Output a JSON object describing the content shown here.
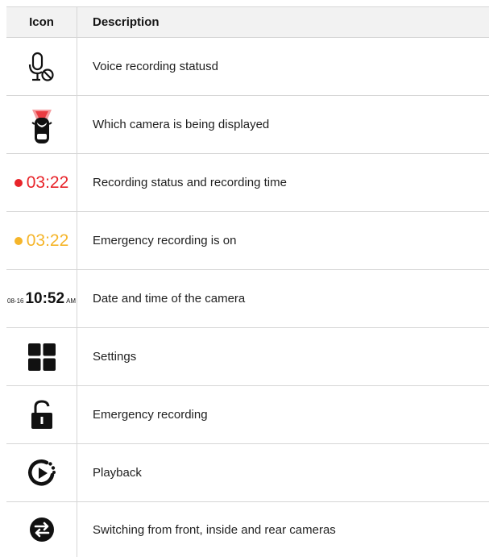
{
  "table": {
    "header": {
      "icon": "Icon",
      "description": "Description"
    },
    "rows": [
      {
        "icon_name": "microphone-off-icon",
        "description": "Voice recording statusd"
      },
      {
        "icon_name": "car-camera-icon",
        "description": "Which camera is being displayed"
      },
      {
        "icon_name": "recording-time-indicator",
        "time": "03:22",
        "color": "#e8242a",
        "description": "Recording status and recording time"
      },
      {
        "icon_name": "emergency-recording-indicator",
        "time": "03:22",
        "color": "#f5b52a",
        "description": "Emergency recording is on"
      },
      {
        "icon_name": "datetime-display",
        "date": "08-16",
        "time": "10:52",
        "ampm": "AM",
        "description": "Date and time of the camera"
      },
      {
        "icon_name": "grid-icon",
        "description": "Settings"
      },
      {
        "icon_name": "unlock-icon",
        "description": "Emergency recording"
      },
      {
        "icon_name": "playback-icon",
        "description": "Playback"
      },
      {
        "icon_name": "switch-arrows-icon",
        "description": " Switching from front, inside and rear cameras"
      }
    ]
  }
}
